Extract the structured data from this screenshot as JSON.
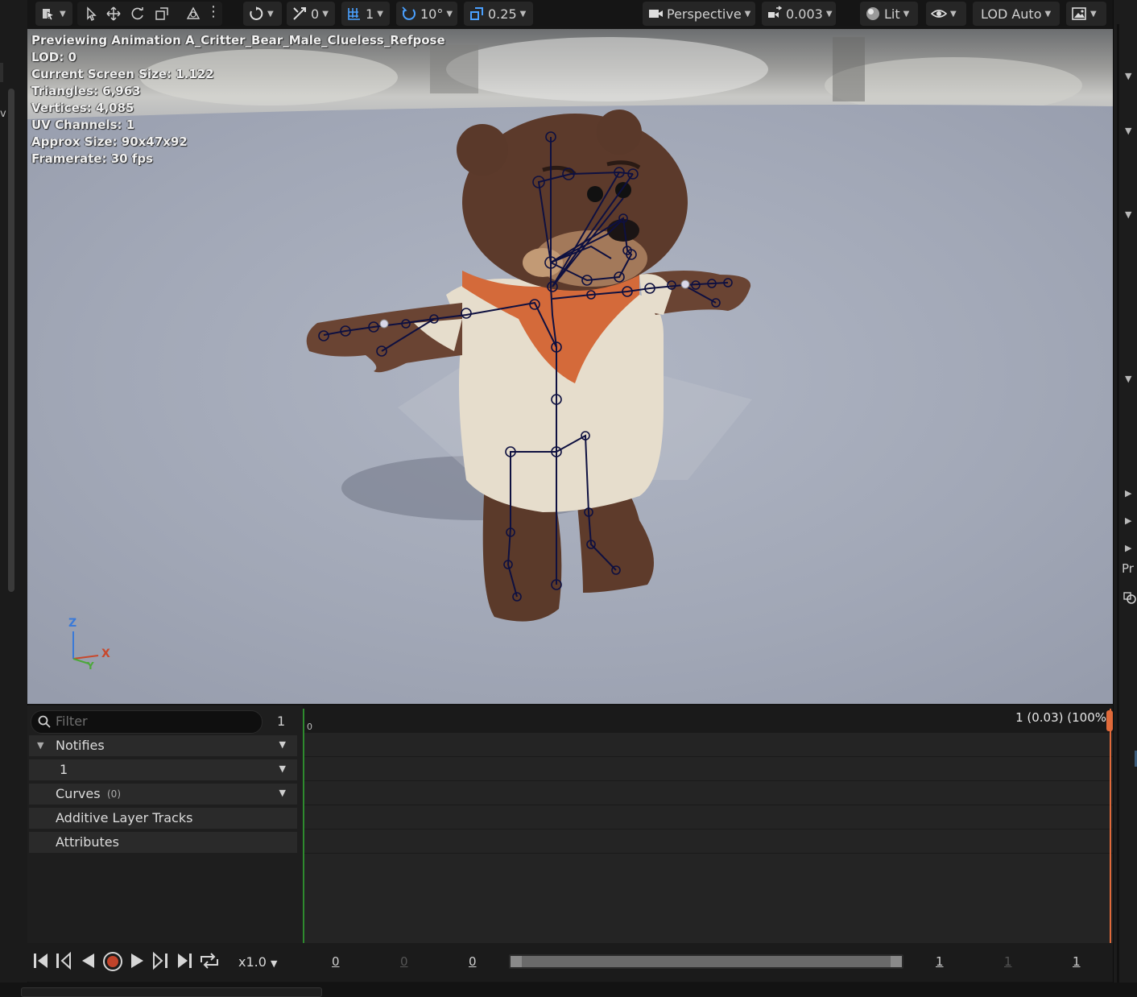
{
  "toolbar": {
    "snap_translate_value": "0",
    "grid_value": "1",
    "rotate_snap_value": "10°",
    "scale_snap_value": "0.25",
    "view_mode": "Perspective",
    "camera_speed_value": "0.003",
    "lighting_mode": "Lit",
    "lod_mode": "LOD Auto"
  },
  "viewport": {
    "overlay": [
      "Previewing Animation A_Critter_Bear_Male_Clueless_Refpose",
      "LOD: 0",
      "Current Screen Size: 1.122",
      "Triangles: 6,963",
      "Vertices: 4,085",
      "UV Channels: 1",
      "Approx Size: 90x47x92",
      "Framerate: 30 fps"
    ],
    "axis_labels": {
      "z": "Z",
      "x": "X",
      "y": "Y"
    }
  },
  "timeline": {
    "filter_placeholder": "Filter",
    "filter_count": "1",
    "tracks": [
      {
        "label": "Notifies",
        "has_dropdown": true
      },
      {
        "label": "1",
        "has_dropdown": true
      },
      {
        "label": "Curves",
        "badge": "(0)",
        "has_dropdown": true
      },
      {
        "label": "Additive Layer Tracks",
        "has_dropdown": false
      },
      {
        "label": "Attributes",
        "has_dropdown": false
      }
    ],
    "ruler_start": "0",
    "frame_readout": "1 (0.03) (100%",
    "playback_speed": "x1.0",
    "range": [
      "0",
      "0",
      "0",
      "1",
      "1",
      "1"
    ]
  },
  "right_strip": {
    "label": "Pr"
  },
  "left_strip": {
    "letter": "v"
  },
  "colors": {
    "bone": "#0e1040",
    "accent_blue": "#4aa0ff",
    "playhead": "#e06a3a",
    "start_marker": "#2e8a2e"
  }
}
